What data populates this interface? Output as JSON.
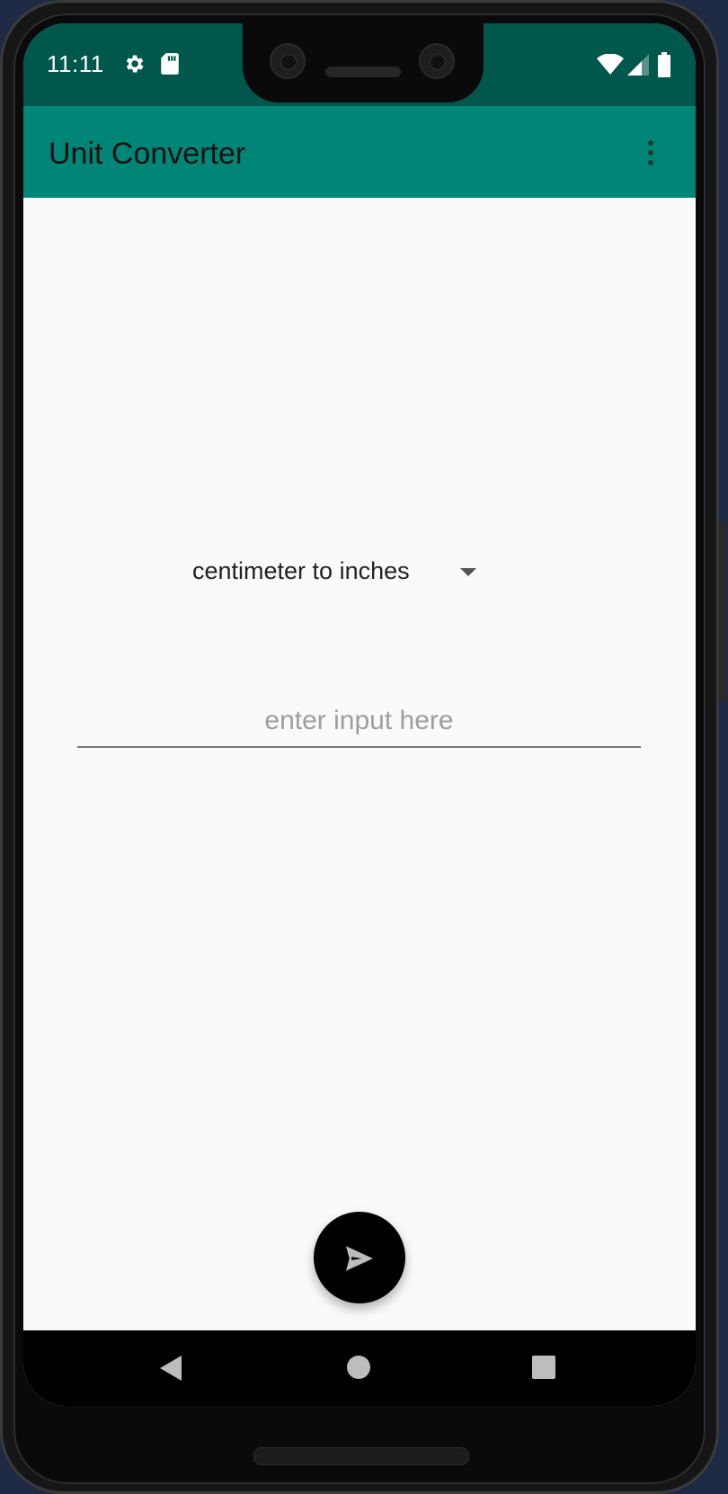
{
  "status_bar": {
    "time": "11:11",
    "icons": [
      "gear-icon",
      "sd-card-icon",
      "wifi-icon",
      "signal-icon",
      "battery-icon"
    ]
  },
  "toolbar": {
    "title": "Unit Converter",
    "menu_icon": "more-vert-icon"
  },
  "converter": {
    "selected_conversion": "centimeter to inches",
    "input_placeholder": "enter input here",
    "input_value": ""
  },
  "fab": {
    "icon": "send-icon"
  },
  "nav_bar": {
    "icons": [
      "back-icon",
      "home-icon",
      "recents-icon"
    ]
  },
  "colors": {
    "status_bar": "#00574b",
    "toolbar": "#008577",
    "background": "#fafafa",
    "fab": "#000000"
  }
}
